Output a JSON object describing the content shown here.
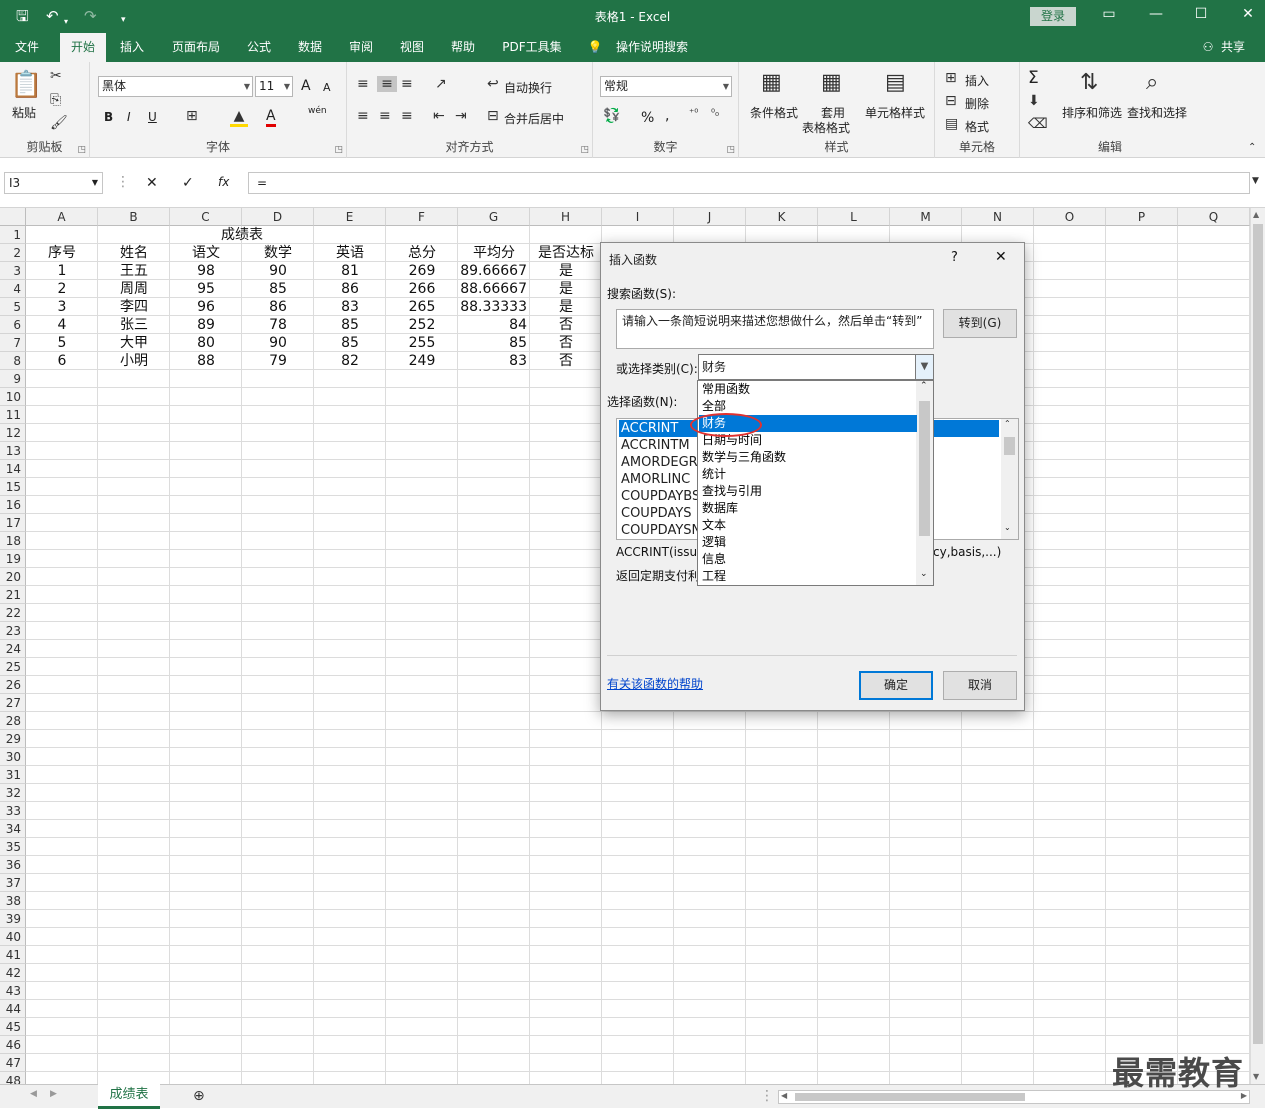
{
  "titlebar": {
    "title": "表格1  -  Excel",
    "login": "登录",
    "save_icon": "save-icon",
    "undo_icon": "undo-icon",
    "redo_icon": "redo-icon"
  },
  "tabs": [
    "文件",
    "开始",
    "插入",
    "页面布局",
    "公式",
    "数据",
    "审阅",
    "视图",
    "帮助",
    "PDF工具集",
    "操作说明搜索"
  ],
  "share": "共享",
  "ribbon": {
    "clipboard": {
      "paste": "粘贴",
      "label": "剪贴板"
    },
    "font": {
      "name": "黑体",
      "size": "11",
      "label": "字体",
      "bold": "B",
      "italic": "I",
      "underline": "U",
      "grow": "A",
      "shrink": "A",
      "fontcolor": "A",
      "phonetic": "wén"
    },
    "align": {
      "wrap": "自动换行",
      "merge": "合并后居中",
      "label": "对齐方式"
    },
    "number": {
      "format": "常规",
      "percent": "%",
      "comma": ",",
      "label": "数字"
    },
    "styles": {
      "cond": "条件格式",
      "table1": "套用",
      "table2": "表格格式",
      "cell": "单元格样式",
      "label": "样式"
    },
    "cells": {
      "insert": "插入",
      "delete": "删除",
      "format": "格式",
      "label": "单元格"
    },
    "edit": {
      "sum": "Σ",
      "sort": "排序和筛选",
      "find": "查找和选择",
      "label": "编辑"
    }
  },
  "formula_bar": {
    "namebox": "I3",
    "cancel": "✕",
    "enter": "✓",
    "fx": "fx",
    "content": "="
  },
  "columns": [
    "A",
    "B",
    "C",
    "D",
    "E",
    "F",
    "G",
    "H",
    "I",
    "J",
    "K",
    "L",
    "M",
    "N",
    "O",
    "P",
    "Q"
  ],
  "rows": [
    "1",
    "2",
    "3",
    "4",
    "5",
    "6",
    "7",
    "8",
    "9",
    "10",
    "11",
    "12",
    "13",
    "14",
    "15",
    "16",
    "17",
    "18",
    "19",
    "20",
    "21",
    "22",
    "23",
    "24",
    "25",
    "26",
    "27",
    "28",
    "29",
    "30",
    "31",
    "32",
    "33",
    "34",
    "35",
    "36",
    "37",
    "38",
    "39",
    "40",
    "41",
    "42",
    "43",
    "44",
    "45",
    "46",
    "47",
    "48"
  ],
  "sheet": {
    "title": "成绩表",
    "headers": [
      "序号",
      "姓名",
      "语文",
      "数学",
      "英语",
      "总分",
      "平均分",
      "是否达标"
    ],
    "data": [
      [
        "1",
        "王五",
        "98",
        "90",
        "81",
        "269",
        "89.66667",
        "是"
      ],
      [
        "2",
        "周周",
        "95",
        "85",
        "86",
        "266",
        "88.66667",
        "是"
      ],
      [
        "3",
        "李四",
        "96",
        "86",
        "83",
        "265",
        "88.33333",
        "是"
      ],
      [
        "4",
        "张三",
        "89",
        "78",
        "85",
        "252",
        "84",
        "否"
      ],
      [
        "5",
        "大甲",
        "80",
        "90",
        "85",
        "255",
        "85",
        "否"
      ],
      [
        "6",
        "小明",
        "88",
        "79",
        "82",
        "249",
        "83",
        "否"
      ]
    ]
  },
  "sheet_tab": "成绩表",
  "dialog": {
    "title": "插入函数",
    "help": "?",
    "close": "✕",
    "search_label": "搜索函数(S):",
    "search_placeholder": "请输入一条简短说明来描述您想做什么，然后单击“转到”",
    "goto": "转到(G)",
    "category_label": "或选择类别(C):",
    "category_value": "财务",
    "func_label": "选择函数(N):",
    "functions": [
      "ACCRINT",
      "ACCRINTM",
      "AMORDEGRC",
      "AMORLINC",
      "COUPDAYBS",
      "COUPDAYS",
      "COUPDAYSNC"
    ],
    "signature_left": "ACCRINT(issue",
    "signature_right": "cy,basis,...)",
    "description": "返回定期支付利",
    "help_link": "有关该函数的帮助",
    "ok": "确定",
    "cancel": "取消",
    "categories": [
      "常用函数",
      "全部",
      "财务",
      "日期与时间",
      "数学与三角函数",
      "统计",
      "查找与引用",
      "数据库",
      "文本",
      "逻辑",
      "信息",
      "工程"
    ]
  },
  "watermark": "最需教育"
}
